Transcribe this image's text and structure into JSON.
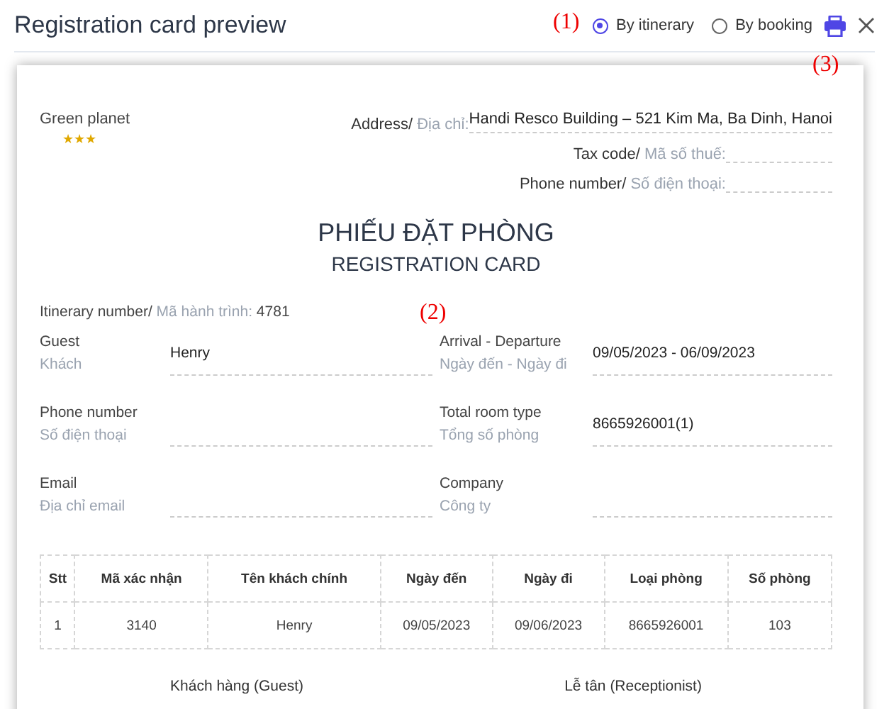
{
  "window": {
    "title": "Registration card preview"
  },
  "view_options": [
    {
      "label": "By itinerary",
      "selected": true
    },
    {
      "label": "By booking",
      "selected": false
    }
  ],
  "annotations": [
    {
      "label": "(1)"
    },
    {
      "label": "(2)"
    },
    {
      "label": "(3)"
    }
  ],
  "card": {
    "hotel": {
      "name": "Green planet",
      "stars": 3
    },
    "hotel_fields": [
      {
        "label": "Address/",
        "label_vi": "Địa chỉ:",
        "value": "Handi Resco Building – 521 Kim Ma, Ba Dinh, Hanoi"
      },
      {
        "label": "Tax code/",
        "label_vi": "Mã số thuế:"
      },
      {
        "label": "Phone number/",
        "label_vi": "Số điện thoại:"
      }
    ],
    "title": "PHIẾU ĐẶT PHÒNG",
    "subtitle": "REGISTRATION CARD",
    "itinerary": {
      "label": "Itinerary number/",
      "label_vi": "Mã hành trình:",
      "value": "4781"
    },
    "fields": [
      {
        "label": "Guest",
        "label_vi": "Khách",
        "value": "Henry"
      },
      {
        "label": "Arrival - Departure",
        "label_vi": "Ngày đến - Ngày đi",
        "value": "09/05/2023 - 06/09/2023"
      },
      {
        "label": "Phone number",
        "label_vi": "Số điện thoại"
      },
      {
        "label": "Total room type",
        "label_vi": "Tổng số phòng",
        "value": "8665926001(1)"
      },
      {
        "label": "Email",
        "label_vi": "Địa chỉ email"
      },
      {
        "label": "Company",
        "label_vi": "Công ty"
      }
    ],
    "table": {
      "columns": [
        "Stt",
        "Mã xác nhận",
        "Tên khách chính",
        "Ngày đến",
        "Ngày đi",
        "Loại phòng",
        "Số phòng"
      ],
      "rows": [
        [
          "1",
          "3140",
          "Henry",
          "09/05/2023",
          "09/06/2023",
          "8665926001",
          "103"
        ]
      ]
    },
    "signatures": [
      "Khách hàng (Guest)",
      "Lễ tân (Receptionist)"
    ]
  }
}
